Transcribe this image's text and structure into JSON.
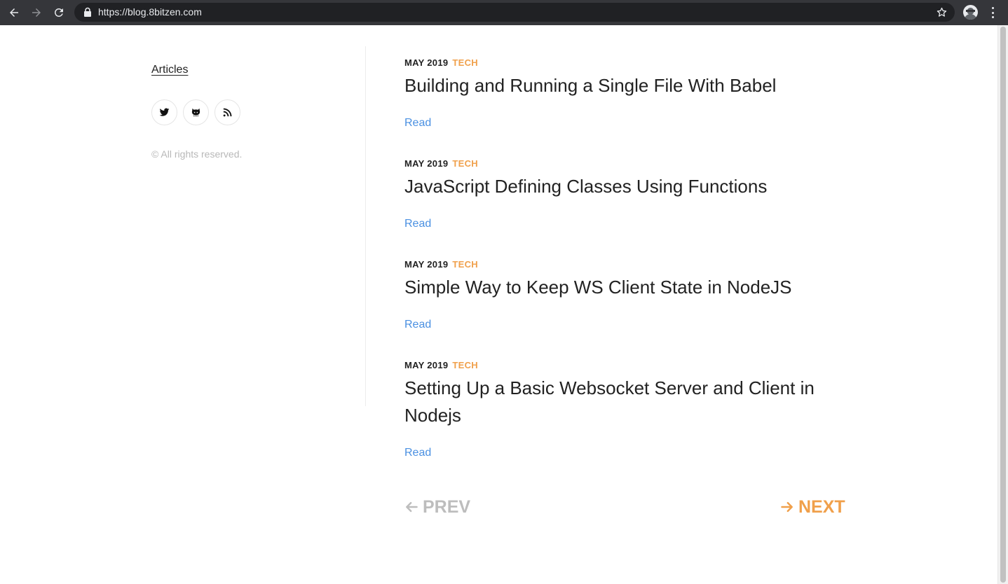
{
  "browser": {
    "url": "https://blog.8bitzen.com"
  },
  "sidebar": {
    "articles_label": "Articles",
    "social": [
      {
        "icon": "twitter-icon"
      },
      {
        "icon": "github-icon"
      },
      {
        "icon": "rss-icon"
      }
    ],
    "copyright": "© All rights reserved."
  },
  "posts": [
    {
      "date": "MAY 2019",
      "tag": "TECH",
      "title": "Building and Running a Single File With Babel",
      "read": "Read"
    },
    {
      "date": "MAY 2019",
      "tag": "TECH",
      "title": "JavaScript Defining Classes Using Functions",
      "read": "Read"
    },
    {
      "date": "MAY 2019",
      "tag": "TECH",
      "title": "Simple Way to Keep WS Client State in NodeJS",
      "read": "Read"
    },
    {
      "date": "MAY 2019",
      "tag": "TECH",
      "title": "Setting Up a Basic Websocket Server and Client in Nodejs",
      "read": "Read"
    }
  ],
  "pagination": {
    "prev": "PREV",
    "next": "NEXT"
  },
  "colors": {
    "accent": "#f0a04b",
    "link": "#4a90e2",
    "text": "#222222",
    "muted": "#bdbdbd"
  }
}
